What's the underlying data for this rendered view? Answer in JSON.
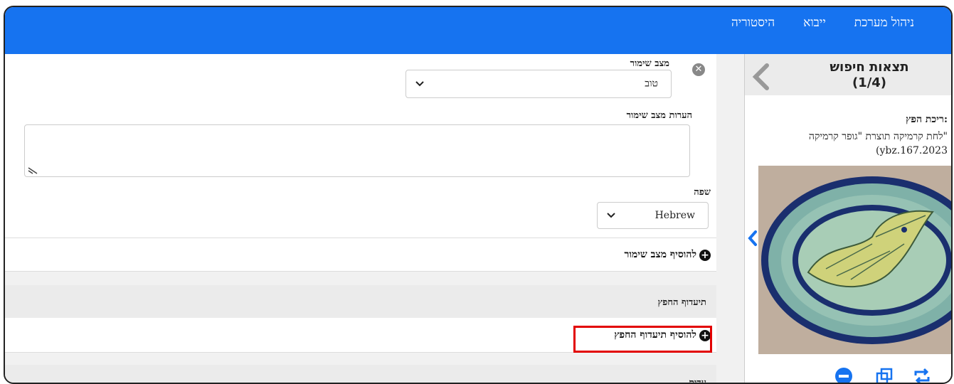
{
  "nav": {
    "items": [
      "ניהול מערכת",
      "ייבוא",
      "היסטוריה"
    ]
  },
  "search": {
    "title_line1": "תצאות חיפוש",
    "title_line2": "(1/4)",
    "object_label": "ריכת הפץ:",
    "desc_line1": "לחת קרמיקה תוצרת \"גופר קרמיקה\"",
    "desc_line2": "(ybz.167.2023",
    "image_alt": "ceramic plate with bird",
    "icons": [
      "eye-icon",
      "swap-icon",
      "duplicate-icon",
      "minus-circle-icon"
    ]
  },
  "form": {
    "preservation_state_label": "מצב שימור",
    "preservation_state_value": "טוב",
    "preservation_notes_label": "הערות מצב שימור",
    "preservation_notes_value": "",
    "language_label": "שפה",
    "language_value": "Hebrew",
    "add_preservation_label": "להוסיף מצב שימור",
    "object_doc_header": "תיעדוף החפץ",
    "add_object_doc_label": "להוסיף תיעדוף החפץ",
    "next_section_header": "עדות"
  },
  "colors": {
    "topbar": "#1673f0",
    "highlight": "#e20000"
  }
}
